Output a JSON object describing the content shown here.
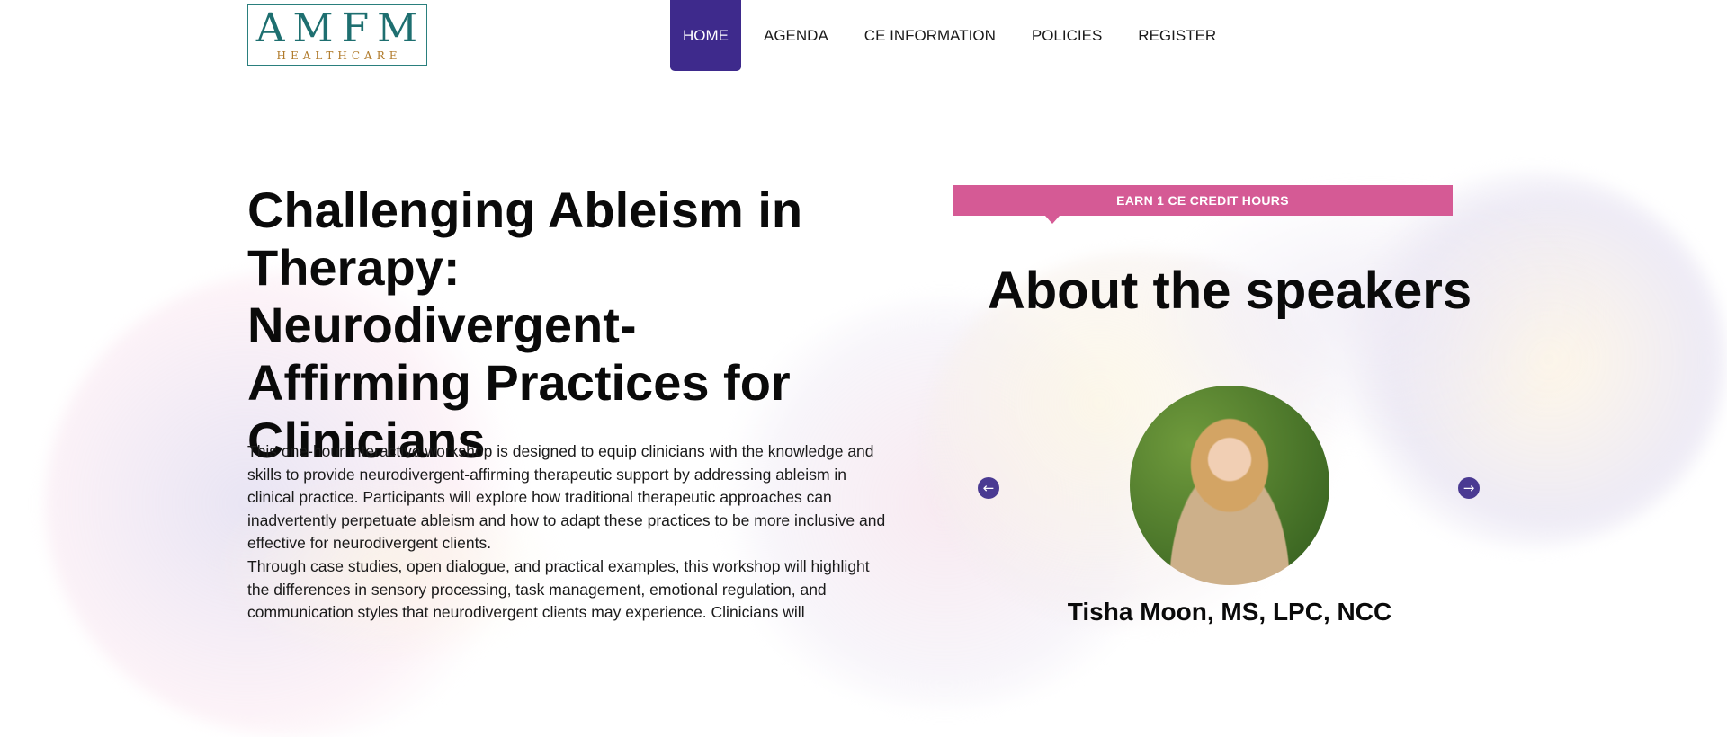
{
  "logo": {
    "main": "AMFM",
    "sub": "HEALTHCARE"
  },
  "nav": {
    "items": [
      {
        "label": "HOME"
      },
      {
        "label": "AGENDA"
      },
      {
        "label": "CE INFORMATION"
      },
      {
        "label": "POLICIES"
      },
      {
        "label": "REGISTER"
      }
    ],
    "active_color": "#3e2a8c"
  },
  "main": {
    "title": "Challenging Ableism in Therapy: Neurodivergent-Affirming Practices for Clinicians",
    "paragraphs": [
      "This one-hour interactive workshop is designed to equip clinicians with the knowledge and skills to provide neurodivergent-affirming therapeutic support by addressing ableism in clinical practice. Participants will explore how traditional therapeutic approaches can inadvertently perpetuate ableism and how to adapt these practices to be more inclusive and effective for neurodivergent clients.",
      "Through case studies, open dialogue, and practical examples, this workshop will highlight the differences in sensory processing, task management, emotional regulation, and communication styles that neurodivergent clients may experience. Clinicians will"
    ]
  },
  "sidebar": {
    "badge": "EARN 1 CE CREDIT HOURS",
    "badge_color": "#d55a95",
    "heading": "About the speakers",
    "prev_icon": "arrow-left-icon",
    "next_icon": "arrow-right-icon",
    "speaker": {
      "name": "Tisha Moon, MS, LPC, NCC"
    }
  }
}
